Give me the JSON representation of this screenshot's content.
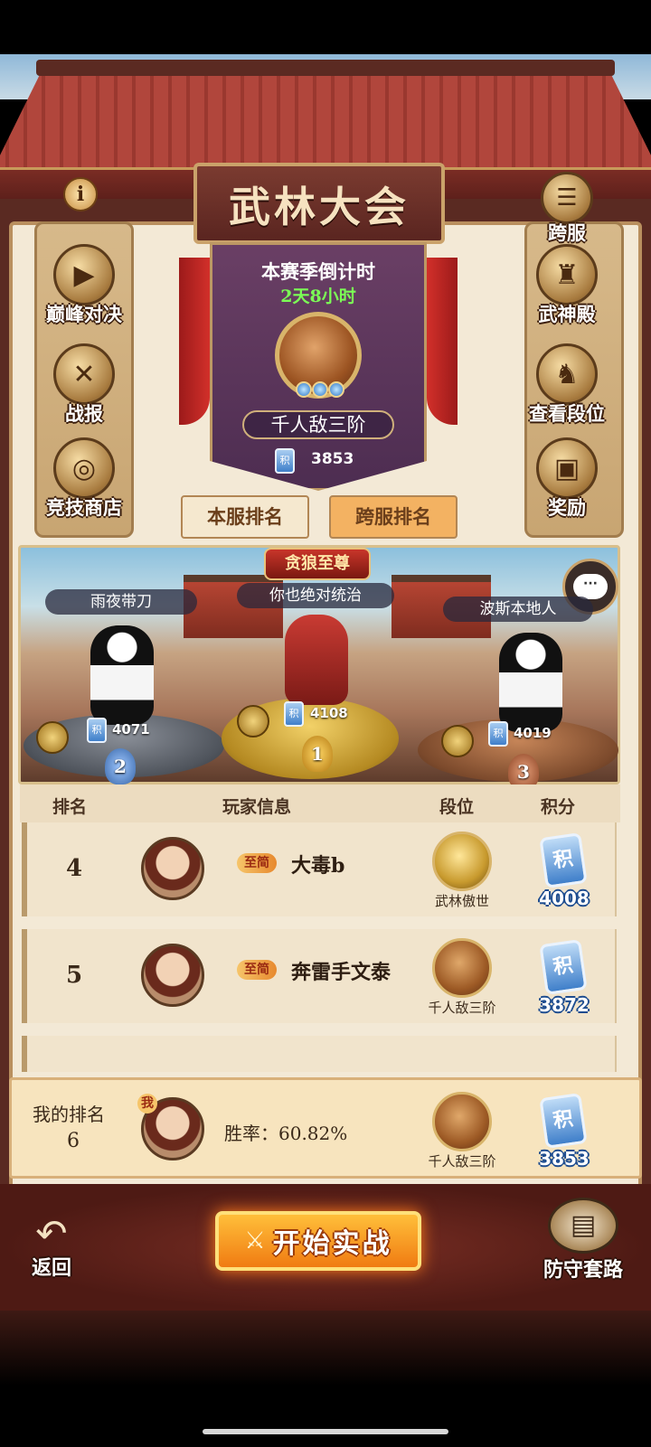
{
  "title": "武林大会",
  "info_icon": "i",
  "left_menu": [
    {
      "label": "巅峰对决",
      "icon": "play-icon"
    },
    {
      "label": "战报",
      "icon": "crossed-swords-icon"
    },
    {
      "label": "竞技商店",
      "icon": "shop-icon"
    }
  ],
  "right_menu": [
    {
      "label": "跨服",
      "icon": "list-icon"
    },
    {
      "label": "武神殿",
      "icon": "hall-icon"
    },
    {
      "label": "查看段位",
      "icon": "dragon-icon"
    },
    {
      "label": "奖励",
      "icon": "chest-icon"
    }
  ],
  "season": {
    "countdown_label": "本赛季倒计时",
    "countdown_value": "2天8小时",
    "tier": "千人敌三阶",
    "score_icon": "积",
    "score": "3853"
  },
  "tabs": {
    "local": "本服排名",
    "cross": "跨服排名"
  },
  "arena": {
    "plaque": "贪狼至尊",
    "podium": [
      {
        "place": "1",
        "name": "你也绝对统治",
        "score": "4108"
      },
      {
        "place": "2",
        "name": "雨夜带刀",
        "score": "4071"
      },
      {
        "place": "3",
        "name": "波斯本地人",
        "score": "4019"
      }
    ],
    "chat_icon": "chat-icon"
  },
  "table": {
    "headers": {
      "rank": "排名",
      "player": "玩家信息",
      "tier": "段位",
      "score": "积分"
    },
    "rows": [
      {
        "rank": "4",
        "tag": "至简",
        "name": "大毒b",
        "tier": "武林傲世",
        "score": "4008"
      },
      {
        "rank": "5",
        "tag": "至简",
        "name": "奔雷手文泰",
        "tier": "千人敌三阶",
        "score": "3872"
      }
    ]
  },
  "my_rank": {
    "label": "我的排名",
    "rank": "6",
    "me_tag": "我",
    "winrate": "胜率：60.82%",
    "tier": "千人敌三阶",
    "score": "3853"
  },
  "bottom": {
    "back": "返回",
    "start": "开始实战",
    "defend": "防守套路"
  }
}
